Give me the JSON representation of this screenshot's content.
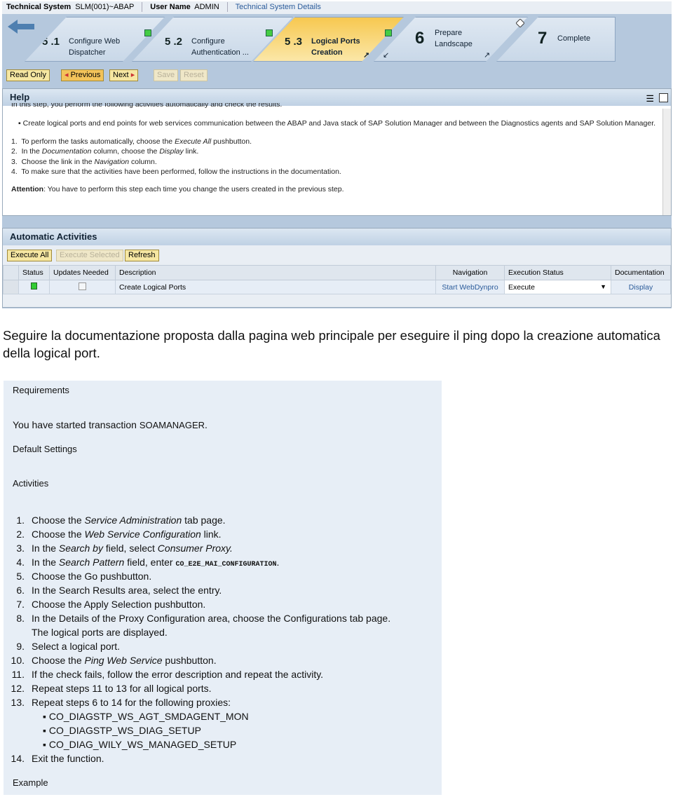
{
  "header": {
    "system_label": "Technical System",
    "system_value": "SLM(001)~ABAP",
    "user_label": "User Name",
    "user_value": "ADMIN",
    "details_link": "Technical System Details"
  },
  "steps": [
    {
      "num": "5 .1",
      "l1": "Configure Web",
      "l2": "Dispatcher",
      "status": "done"
    },
    {
      "num": "5 .2",
      "l1": "Configure",
      "l2": "Authentication ...",
      "status": "done"
    },
    {
      "num": "5 .3",
      "l1": "Logical Ports",
      "l2": "Creation",
      "status": "active"
    },
    {
      "num": "6",
      "l1": "Prepare",
      "l2": "Landscape",
      "status": "todo"
    },
    {
      "num": "7",
      "l1": "Complete",
      "l2": "",
      "status": "todo"
    }
  ],
  "toolbar": {
    "read_only": "Read Only",
    "previous": "Previous",
    "next": "Next",
    "save": "Save",
    "reset": "Reset"
  },
  "help": {
    "title": "Help",
    "intro": "In this step, you perform the following activities automatically and check the results.",
    "bullet": "Create logical ports and end points for web services communication between the ABAP and Java stack of SAP Solution Manager and between the Diagnostics agents and SAP Solution Manager.",
    "s1a": "To perform the tasks automatically, choose the ",
    "s1b": "Execute All",
    "s1c": " pushbutton.",
    "s2a": "In the ",
    "s2b": "Documentation",
    "s2c": " column, choose the ",
    "s2d": "Display",
    "s2e": " link.",
    "s3a": "Choose the link in the ",
    "s3b": "Navigation",
    "s3c": " column.",
    "s4": "To make sure that the activities have been performed, follow the instructions in the documentation.",
    "att_label": "Attention",
    "att_text": ": You have to perform this step each time you change the users created in the previous step."
  },
  "auto": {
    "title": "Automatic Activities",
    "execute_all": "Execute All",
    "execute_selected": "Execute Selected",
    "refresh": "Refresh",
    "columns": [
      "Status",
      "Updates Needed",
      "Description",
      "Navigation",
      "Execution Status",
      "Documentation"
    ],
    "row": {
      "description": "Create Logical Ports",
      "navigation": "Start WebDynpro",
      "execution_status": "Execute",
      "documentation": "Display"
    }
  },
  "caption": "Seguire la documentazione proposta dalla pagina web principale per eseguire il ping dopo la creazione automatica della logical port.",
  "doc": {
    "requirements": "Requirements",
    "req_text_a": "You have started transaction ",
    "req_text_b": "SOAMANAGER",
    "req_text_c": ".",
    "default_settings": "Default Settings",
    "activities": "Activities",
    "a1a": "Choose the ",
    "a1b": "Service Administration",
    "a1c": " tab page.",
    "a2a": "Choose the ",
    "a2b": "Web Service Configuration",
    "a2c": " link.",
    "a3a": "In the ",
    "a3b": "Search by",
    "a3c": " field, select ",
    "a3d": "Consumer Proxy.",
    "a4a": "In the ",
    "a4b": "Search Pattern",
    "a4c": " field, enter ",
    "a4d": "CO_E2E_MAI_CONFIGURATION",
    "a4e": ".",
    "a5": "Choose the Go pushbutton.",
    "a6": "In the Search Results area, select the entry.",
    "a7": "Choose the Apply Selection pushbutton.",
    "a8": "In the Details of the Proxy Configuration area, choose the Configurations tab page.",
    "a8b": "The logical ports are displayed.",
    "a9": "Select a logical port.",
    "a10a": "Choose the ",
    "a10b": "Ping Web Service",
    "a10c": " pushbutton.",
    "a11": "If the check fails, follow the error description and repeat the activity.",
    "a12": "Repeat steps 11 to 13 for all logical ports.",
    "a13": "Repeat steps 6 to 14 for the following proxies:",
    "proxies": [
      "CO_DIAGSTP_WS_AGT_SMDAGENT_MON",
      "CO_DIAGSTP_WS_DIAG_SETUP",
      "CO_DIAG_WILY_WS_MANAGED_SETUP"
    ],
    "a14": "Exit the function.",
    "example": "Example"
  }
}
